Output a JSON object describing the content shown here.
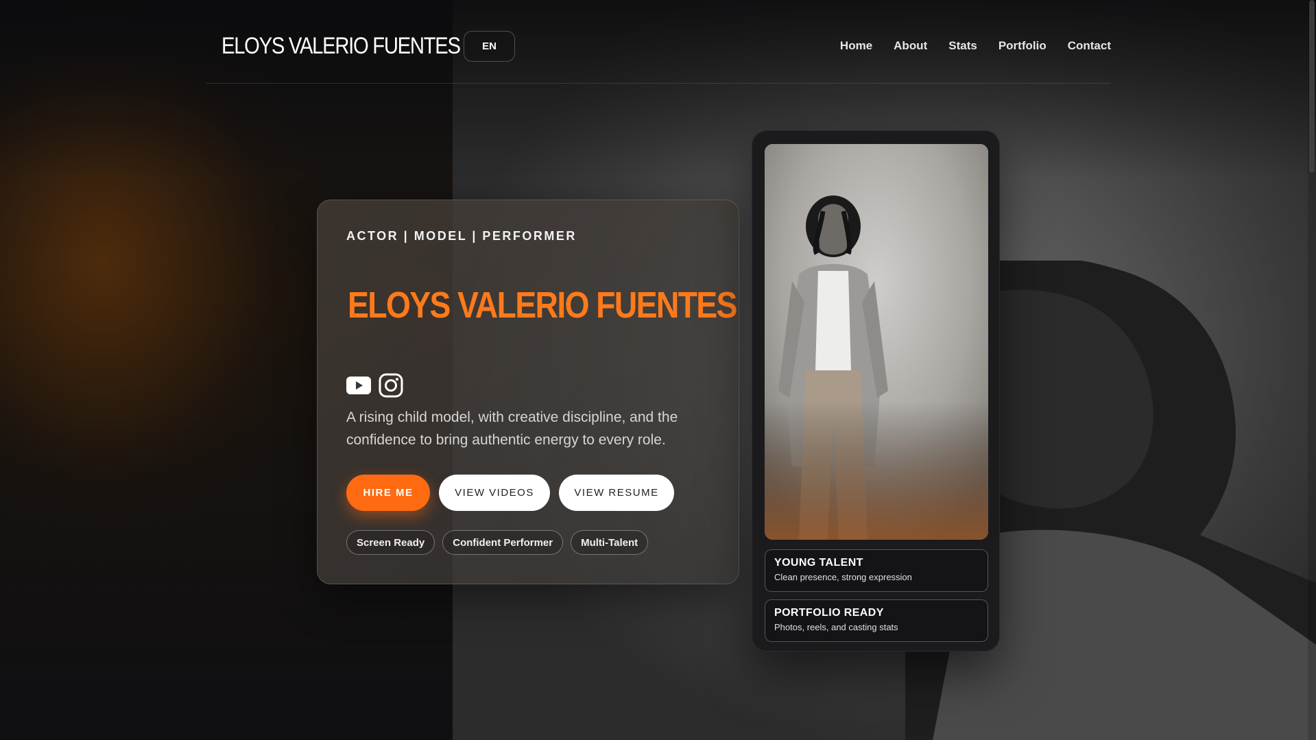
{
  "header": {
    "brand": "ELOYS VALERIO FUENTES",
    "language": "EN",
    "nav": [
      "Home",
      "About",
      "Stats",
      "Portfolio",
      "Contact"
    ]
  },
  "hero": {
    "kicker": "ACTOR | MODEL | PERFORMER",
    "name": "ELOYS VALERIO FUENTES",
    "socials": [
      "youtube-icon",
      "instagram-icon"
    ],
    "description": "A rising child model, with creative discipline, and the confidence to bring authentic energy to every role.",
    "buttons": {
      "hire": "HIRE ME",
      "videos": "VIEW VIDEOS",
      "resume": "VIEW RESUME"
    },
    "tags": [
      "Screen Ready",
      "Confident Performer",
      "Multi-Talent"
    ]
  },
  "profile": {
    "cards": [
      {
        "title": "YOUNG TALENT",
        "subtitle": "Clean presence, strong expression"
      },
      {
        "title": "PORTFOLIO READY",
        "subtitle": "Photos, reels, and casting stats"
      }
    ]
  },
  "colors": {
    "accent": "#ff7a1a",
    "button_primary": "#ff6b12",
    "card_dark": "#1b1b1e"
  }
}
